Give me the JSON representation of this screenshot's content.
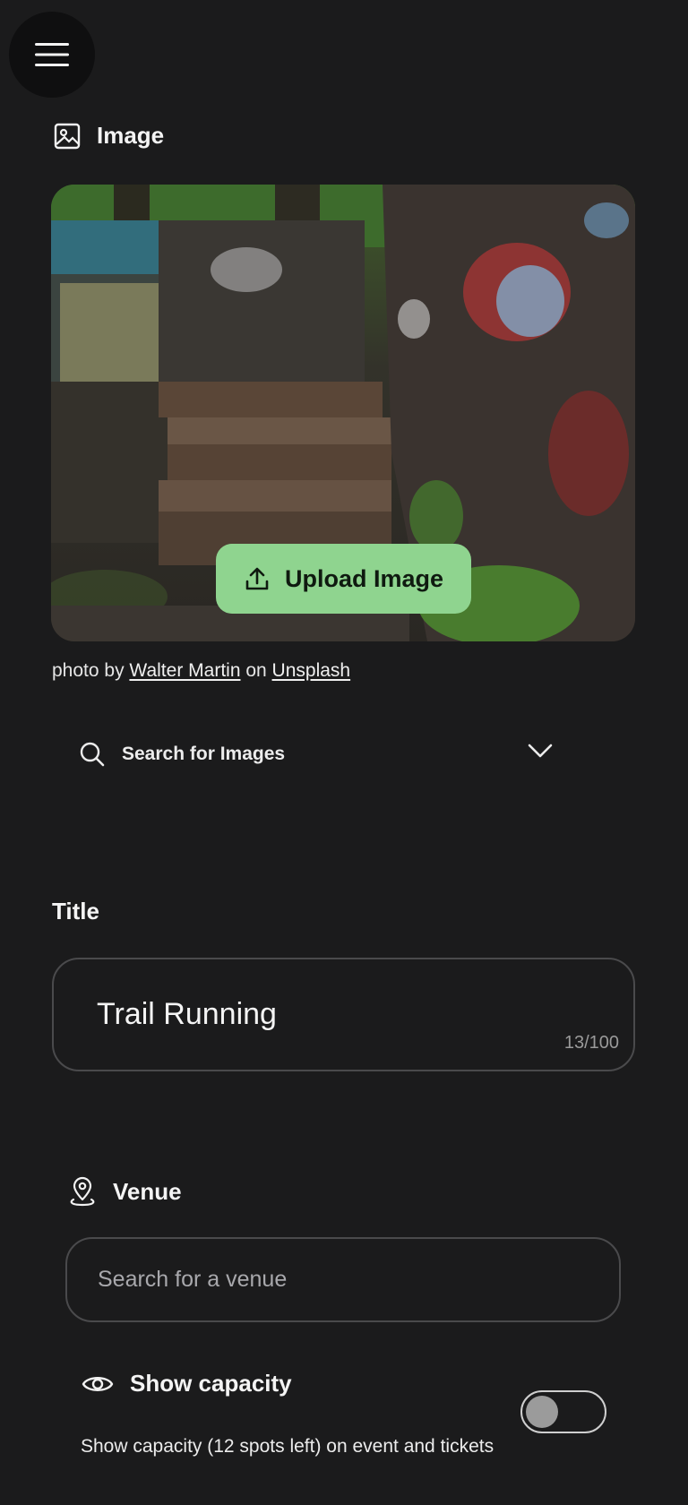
{
  "menu": {
    "icon": "hamburger-menu-icon"
  },
  "image_section": {
    "heading": "Image",
    "icon": "image-icon",
    "upload_label": "Upload Image",
    "credit": {
      "prefix": "photo by",
      "author": "Walter Martin",
      "middle": "on",
      "source": "Unsplash"
    },
    "search_label": "Search for Images"
  },
  "title_section": {
    "label": "Title",
    "value": "Trail Running",
    "counter": "13/100"
  },
  "venue_section": {
    "heading": "Venue",
    "icon": "map-pin-icon",
    "placeholder": "Search for a venue"
  },
  "capacity_section": {
    "heading": "Show capacity",
    "icon": "eye-icon",
    "description": "Show capacity (12 spots left) on event and tickets",
    "toggle_on": false
  },
  "colors": {
    "background": "#1b1b1c",
    "accent_button": "#8fd48f",
    "border": "#4a4a4c"
  }
}
